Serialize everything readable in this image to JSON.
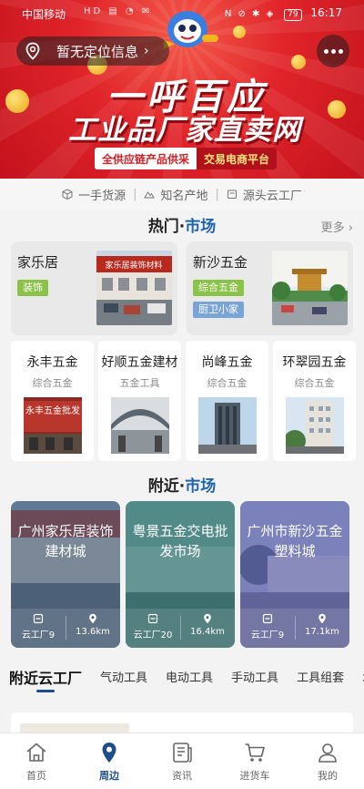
{
  "status_bar": {
    "carrier": "中国移动",
    "sys_icons": "HD ▤ ◔ ✉",
    "signal": "N ⊘ ✱ ◈",
    "battery": "79",
    "time": "16:17"
  },
  "header": {
    "location_text": "暂无定位信息",
    "location_chevron": "›",
    "more_icon": "more-dots-icon"
  },
  "banner": {
    "title": "一呼百应",
    "subtitle": "工业品厂家直卖网",
    "tag_left": "全供应链产品供采",
    "tag_right": "交易电商平台"
  },
  "features": [
    {
      "label": "一手货源",
      "icon": "box-icon"
    },
    {
      "label": "知名产地",
      "icon": "mountain-icon"
    },
    {
      "label": "源头云工厂",
      "icon": "factory-icon"
    }
  ],
  "hot_section": {
    "title_a": "热门·",
    "title_b": "市场",
    "more": "更多 ›",
    "featured": [
      {
        "name": "家乐居",
        "tags": [
          {
            "label": "装饰",
            "color": "#8bc34a"
          }
        ],
        "photo_sign": "家乐居装饰材料"
      },
      {
        "name": "新沙五金",
        "tags": [
          {
            "label": "综合五金",
            "color": "#8bc34a"
          },
          {
            "label": "厨卫小家",
            "color": "#7aa3d6"
          }
        ]
      }
    ],
    "markets": [
      {
        "name": "永丰五金",
        "category": "综合五金",
        "photo_sign": "永丰五金批发"
      },
      {
        "name": "好顺五金建材",
        "category": "五金工具"
      },
      {
        "name": "尚峰五金",
        "category": "综合五金"
      },
      {
        "name": "环翠园五金",
        "category": "综合五金"
      }
    ]
  },
  "nearby_section": {
    "title_a": "附近·",
    "title_b": "市场",
    "cards": [
      {
        "title": "广州家乐居装饰建材城",
        "factories": "云工厂9",
        "distance": "13.6km",
        "tint": "#2f4a6e"
      },
      {
        "title": "粤景五金交电批发市场",
        "factories": "云工厂20",
        "distance": "16.4km",
        "tint": "#1f6a6a"
      },
      {
        "title": "广州市新沙五金塑料城",
        "factories": "云工厂9",
        "distance": "17.1km",
        "tint": "#4b4f9a"
      }
    ]
  },
  "tabs": [
    "附近云工厂",
    "气动工具",
    "电动工具",
    "手动工具",
    "工具组套",
    "水"
  ],
  "bottom_nav": [
    {
      "label": "首页",
      "icon": "home-icon"
    },
    {
      "label": "周边",
      "icon": "map-pin-icon"
    },
    {
      "label": "资讯",
      "icon": "news-icon"
    },
    {
      "label": "进货车",
      "icon": "cart-icon"
    },
    {
      "label": "我的",
      "icon": "user-icon"
    }
  ],
  "colors": {
    "brand_red": "#e0242a",
    "accent_blue": "#1e63b0",
    "nav_active": "#1e4e8c",
    "tag_green": "#8bc34a",
    "tag_blue": "#7aa3d6"
  }
}
